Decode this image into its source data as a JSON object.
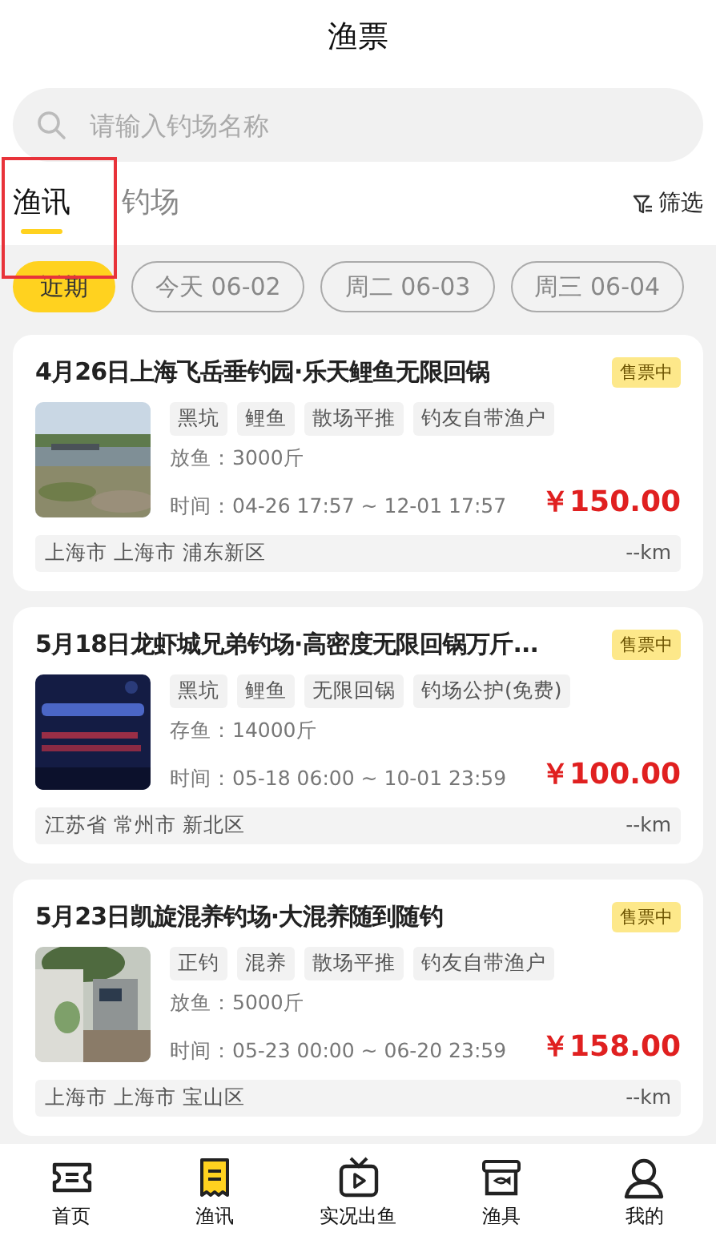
{
  "header": {
    "title": "渔票"
  },
  "search": {
    "placeholder": "请输入钓场名称"
  },
  "tabs": [
    {
      "label": "渔讯",
      "selected": true
    },
    {
      "label": "钓场",
      "selected": false
    }
  ],
  "filter": {
    "label": "筛选"
  },
  "highlight": {
    "on": true
  },
  "date_chips": [
    {
      "label": "近期",
      "selected": true
    },
    {
      "label": "今天 06-02",
      "selected": false
    },
    {
      "label": "周二 06-03",
      "selected": false
    },
    {
      "label": "周三 06-04",
      "selected": false
    }
  ],
  "listings": [
    {
      "title": "4月26日上海飞岳垂钓园·乐天鲤鱼无限回锅",
      "status": "售票中",
      "image": {
        "kind": "picture"
      },
      "tags": [
        "黑坑",
        "鲤鱼",
        "散场平推",
        "钓友自带渔户"
      ],
      "fish": "放鱼：3000斤",
      "time": "时间：04-26 17:57 ~ 12-01 17:57",
      "price": "￥150.00",
      "location": "上海市 上海市 浦东新区",
      "distance": "--km"
    },
    {
      "title": "5月18日龙虾城兄弟钓场·高密度无限回锅万斤...",
      "status": "售票中",
      "image": {
        "kind": "picture"
      },
      "tags": [
        "黑坑",
        "鲤鱼",
        "无限回锅",
        "钓场公护(免费)"
      ],
      "fish": "存鱼：14000斤",
      "time": "时间：05-18 06:00 ~ 10-01 23:59",
      "price": "￥100.00",
      "location": "江苏省 常州市 新北区",
      "distance": "--km"
    },
    {
      "title": "5月23日凯旋混养钓场·大混养随到随钓",
      "status": "售票中",
      "image": {
        "kind": "picture"
      },
      "tags": [
        "正钓",
        "混养",
        "散场平推",
        "钓友自带渔户"
      ],
      "fish": "放鱼：5000斤",
      "time": "时间：05-23 00:00 ~ 06-20 23:59",
      "price": "￥158.00",
      "location": "上海市 上海市 宝山区",
      "distance": "--km"
    }
  ],
  "bottom_nav": [
    {
      "label": "首页",
      "selected": false
    },
    {
      "label": "渔讯",
      "selected": true
    },
    {
      "label": "实况出鱼",
      "selected": false
    },
    {
      "label": "渔具",
      "selected": false
    },
    {
      "label": "我的",
      "selected": false
    }
  ]
}
